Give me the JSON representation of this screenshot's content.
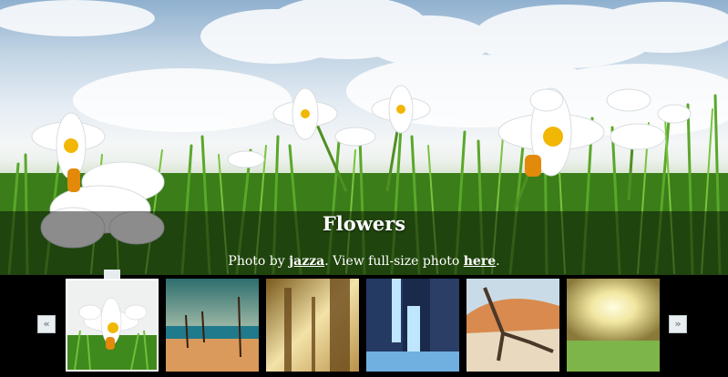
{
  "slide": {
    "title": "Flowers",
    "credit_prefix": "Photo by ",
    "author": "jazza",
    "credit_middle": ". View full-size photo ",
    "link_label": "here",
    "credit_suffix": "."
  },
  "navigation": {
    "prev_label": "«",
    "next_label": "»",
    "prev_icon": "double-chevron-left-icon",
    "next_icon": "double-chevron-right-icon"
  },
  "thumbnails": [
    {
      "subject": "flowers",
      "active": true
    },
    {
      "subject": "beach"
    },
    {
      "subject": "forest"
    },
    {
      "subject": "waterfall"
    },
    {
      "subject": "desert"
    },
    {
      "subject": "sunset-field"
    }
  ],
  "colors": {
    "caption_band": "#000000",
    "caption_text": "#ffffff",
    "active_border": "#ffffff",
    "nav_button": "#e9eef0"
  }
}
